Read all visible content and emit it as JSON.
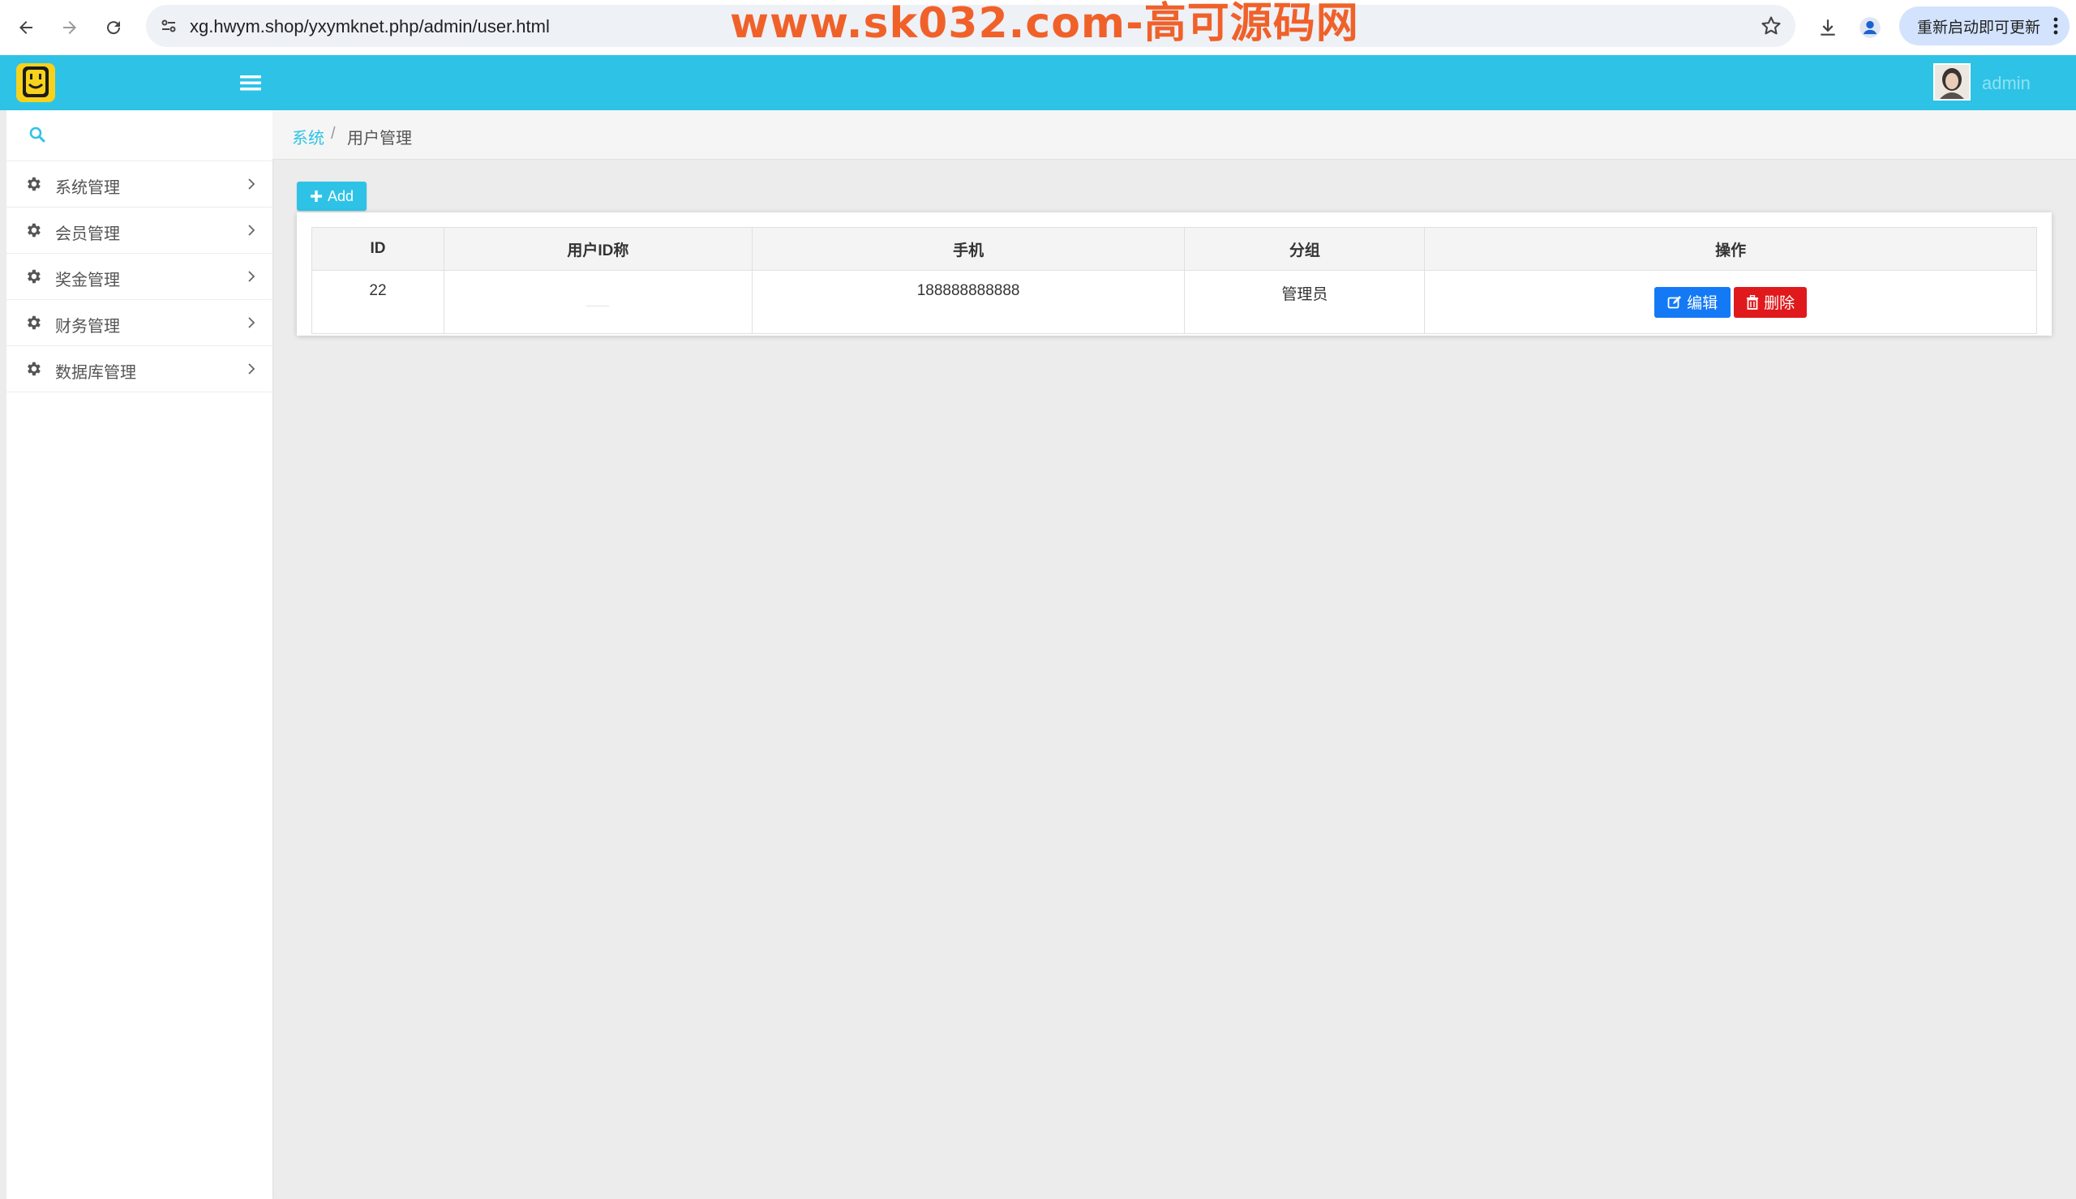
{
  "browser": {
    "url": "xg.hwym.shop/yxymknet.php/admin/user.html",
    "watermark": "www.sk032.com-高可源码网",
    "update_label": "重新启动即可更新"
  },
  "header": {
    "user_name": "admin"
  },
  "sidebar": {
    "items": [
      {
        "label": "系统管理"
      },
      {
        "label": "会员管理"
      },
      {
        "label": "奖金管理"
      },
      {
        "label": "财务管理"
      },
      {
        "label": "数据库管理"
      }
    ]
  },
  "breadcrumb": {
    "root": "系统",
    "separator": "/",
    "current": "用户管理"
  },
  "toolbar": {
    "add_label": "Add"
  },
  "table": {
    "columns": [
      "ID",
      "用户ID称",
      "手机",
      "分组",
      "操作"
    ],
    "rows": [
      {
        "id": "22",
        "name": "",
        "phone": "188888888888",
        "group": "管理员",
        "edit_label": "编辑",
        "delete_label": "删除"
      }
    ]
  },
  "colors": {
    "accent": "#2ec3e6",
    "edit": "#1479f5",
    "delete": "#e0191c",
    "watermark": "#f0612a"
  }
}
